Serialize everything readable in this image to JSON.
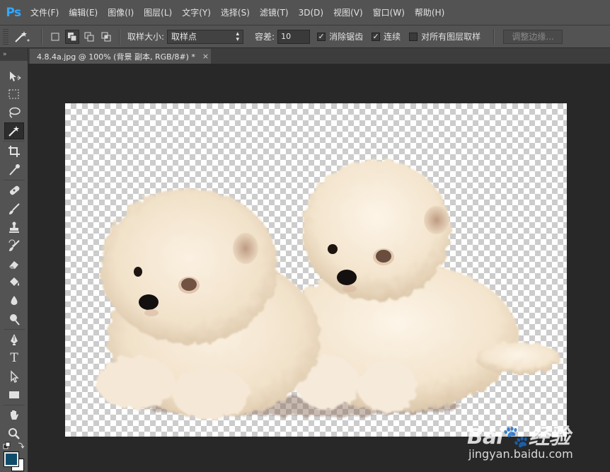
{
  "app": {
    "logo": "Ps",
    "accent_color": "#31a8ff"
  },
  "menu": [
    "文件(F)",
    "编辑(E)",
    "图像(I)",
    "图层(L)",
    "文字(Y)",
    "选择(S)",
    "滤镜(T)",
    "3D(D)",
    "视图(V)",
    "窗口(W)",
    "帮助(H)"
  ],
  "options": {
    "tool_icon": "magic-wand-icon",
    "sample_size_label": "取样大小:",
    "sample_size_value": "取样点",
    "tolerance_label": "容差:",
    "tolerance_value": "10",
    "antialias_label": "消除锯齿",
    "antialias_checked": true,
    "contiguous_label": "连续",
    "contiguous_checked": true,
    "sample_all_label": "对所有图层取样",
    "sample_all_checked": false,
    "refine_edge_label": "调整边缘..."
  },
  "document": {
    "tab_title": "4.8.4a.jpg @ 100% (背景 副本, RGB/8#) *",
    "close_symbol": "×"
  },
  "toolbox": {
    "header": "»",
    "tools": [
      "move-tool",
      "marquee-tool",
      "lasso-tool",
      "magic-wand-tool",
      "crop-tool",
      "eyedropper-tool",
      "healing-brush-tool",
      "brush-tool",
      "clone-stamp-tool",
      "history-brush-tool",
      "eraser-tool",
      "paint-bucket-tool",
      "blur-tool",
      "dodge-tool",
      "pen-tool",
      "type-tool",
      "path-selection-tool",
      "rectangle-tool",
      "hand-tool",
      "zoom-tool"
    ],
    "active_tool": "magic-wand-tool",
    "type_tool_glyph": "T",
    "foreground_color": "#0f4c6b",
    "background_color": "#ffffff"
  },
  "watermark": {
    "logo": "Bai",
    "logo_suffix": "经验",
    "url": "jingyan.baidu.com"
  }
}
